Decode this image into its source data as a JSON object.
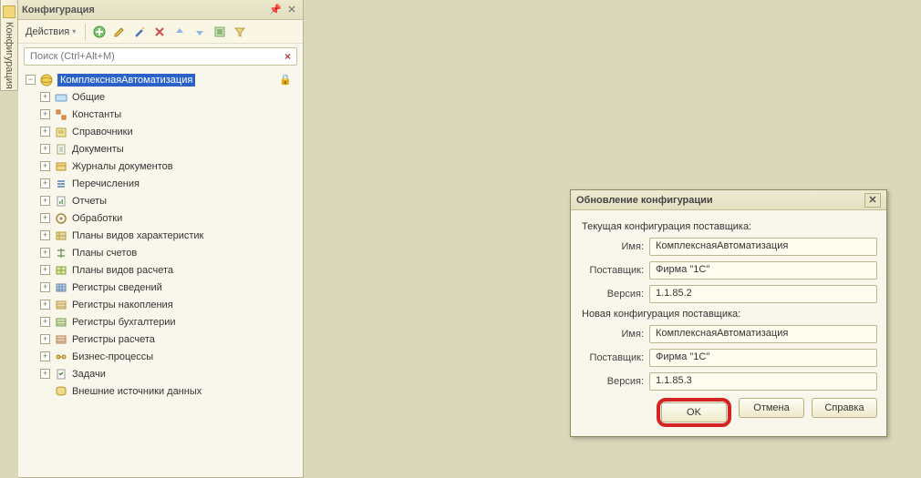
{
  "panel": {
    "title": "Конфигурация",
    "actions_label": "Действия",
    "search_placeholder": "Поиск (Ctrl+Alt+M)"
  },
  "sidebar_tab": "Конфигурация",
  "tree": {
    "root": "КомплекснаяАвтоматизация",
    "items": [
      {
        "label": "Общие"
      },
      {
        "label": "Константы"
      },
      {
        "label": "Справочники"
      },
      {
        "label": "Документы"
      },
      {
        "label": "Журналы документов"
      },
      {
        "label": "Перечисления"
      },
      {
        "label": "Отчеты"
      },
      {
        "label": "Обработки"
      },
      {
        "label": "Планы видов характеристик"
      },
      {
        "label": "Планы счетов"
      },
      {
        "label": "Планы видов расчета"
      },
      {
        "label": "Регистры сведений"
      },
      {
        "label": "Регистры накопления"
      },
      {
        "label": "Регистры бухгалтерии"
      },
      {
        "label": "Регистры расчета"
      },
      {
        "label": "Бизнес-процессы"
      },
      {
        "label": "Задачи"
      },
      {
        "label": "Внешние источники данных"
      }
    ]
  },
  "dialog": {
    "title": "Обновление конфигурации",
    "current_section": "Текущая конфигурация поставщика:",
    "new_section": "Новая конфигурация поставщика:",
    "labels": {
      "name": "Имя:",
      "vendor": "Поставщик:",
      "version": "Версия:"
    },
    "current": {
      "name": "КомплекснаяАвтоматизация",
      "vendor": "Фирма \"1С\"",
      "version": "1.1.85.2"
    },
    "next": {
      "name": "КомплекснаяАвтоматизация",
      "vendor": "Фирма \"1С\"",
      "version": "1.1.85.3"
    },
    "buttons": {
      "ok": "OK",
      "cancel": "Отмена",
      "help": "Справка"
    }
  }
}
